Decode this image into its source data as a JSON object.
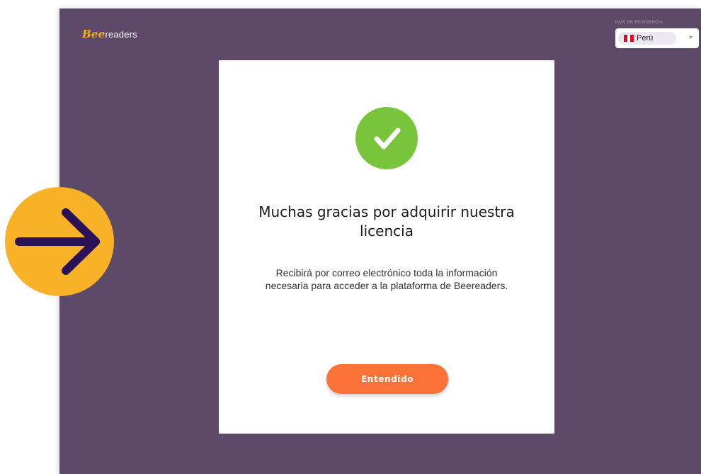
{
  "logo": {
    "prefix": "Bee",
    "suffix": "readers"
  },
  "country": {
    "label": "PAÍS DE RESIDENCIA",
    "value": "Perú",
    "flag_icon": "peru-flag-icon"
  },
  "dialog": {
    "status_icon": "check-circle-icon",
    "title": "Muchas gracias por adquirir nuestra licencia",
    "description": "Recibirá por correo electrónico toda la información necesaria para acceder a la plataforma de Beereaders.",
    "button_label": "Entendido"
  },
  "overlay": {
    "icon": "arrow-right-icon"
  },
  "colors": {
    "background": "#5c4a68",
    "success": "#78c43a",
    "button": "#fd7239",
    "arrow_badge": "#f8b227",
    "arrow": "#2b1257"
  }
}
